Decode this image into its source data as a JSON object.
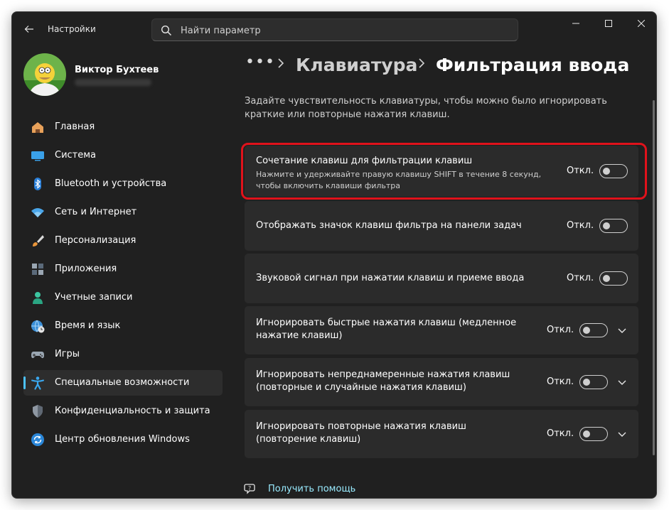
{
  "app": {
    "title": "Настройки"
  },
  "search": {
    "placeholder": "Найти параметр"
  },
  "user": {
    "name": "Виктор Бухтеев"
  },
  "nav": [
    {
      "label": "Главная",
      "icon": "home-icon"
    },
    {
      "label": "Система",
      "icon": "monitor-icon"
    },
    {
      "label": "Bluetooth и устройства",
      "icon": "bluetooth-icon"
    },
    {
      "label": "Сеть и Интернет",
      "icon": "wifi-icon"
    },
    {
      "label": "Персонализация",
      "icon": "brush-icon"
    },
    {
      "label": "Приложения",
      "icon": "apps-icon"
    },
    {
      "label": "Учетные записи",
      "icon": "person-icon"
    },
    {
      "label": "Время и язык",
      "icon": "globe-clock-icon"
    },
    {
      "label": "Игры",
      "icon": "gamepad-icon"
    },
    {
      "label": "Специальные возможности",
      "icon": "accessibility-icon",
      "active": true
    },
    {
      "label": "Конфиденциальность и защита",
      "icon": "shield-icon"
    },
    {
      "label": "Центр обновления Windows",
      "icon": "sync-icon"
    }
  ],
  "breadcrumb": {
    "dots": "•••",
    "parent": "Клавиатура",
    "current": "Фильтрация ввода"
  },
  "description": "Задайте чувствительность клавиатуры, чтобы можно было игнорировать краткие или повторные нажатия клавиш.",
  "settings": [
    {
      "title": "Сочетание клавиш для фильтрации клавиш",
      "subtitle": "Нажмите и удерживайте правую клавишу SHIFT в течение 8 секунд, чтобы включить клавиши фильтра",
      "state": "Откл.",
      "on": false,
      "expandable": false,
      "highlighted": true
    },
    {
      "title": "Отображать значок клавиш фильтра на панели задач",
      "state": "Откл.",
      "on": false,
      "expandable": false
    },
    {
      "title": "Звуковой сигнал при нажатии клавиш и приеме ввода",
      "state": "Откл.",
      "on": false,
      "expandable": false
    },
    {
      "title": "Игнорировать быстрые нажатия клавиш (медленное нажатие клавиш)",
      "state": "Откл.",
      "on": false,
      "expandable": true
    },
    {
      "title": "Игнорировать непреднамеренные нажатия клавиш (повторные и случайные нажатия клавиш)",
      "state": "Откл.",
      "on": false,
      "expandable": true
    },
    {
      "title": "Игнорировать повторные нажатия клавиш (повторение клавиш)",
      "state": "Откл.",
      "on": false,
      "expandable": true
    }
  ],
  "help": {
    "label": "Получить помощь"
  },
  "colors": {
    "accent": "#4cc2ff",
    "highlight": "#e0121b",
    "background": "#202020",
    "card": "#2b2b2b"
  }
}
